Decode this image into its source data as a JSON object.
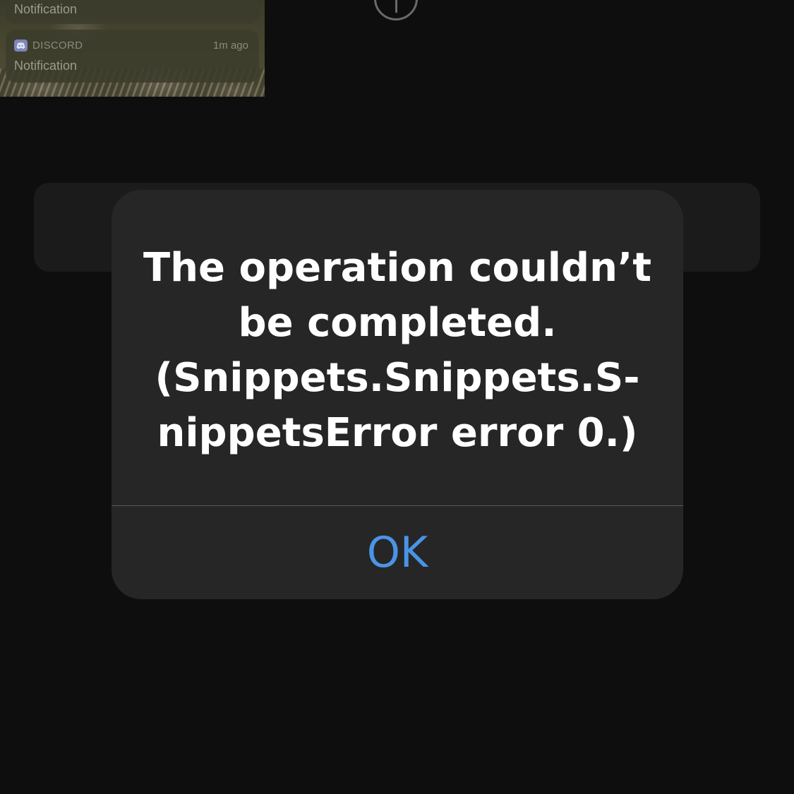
{
  "notifications": [
    {
      "body": "Notification"
    },
    {
      "app": "DISCORD",
      "time": "1m ago",
      "body": "Notification"
    }
  ],
  "add_button": {
    "icon": "plus-icon"
  },
  "alert": {
    "message": "The operation couldn’t\nbe completed.\n(Snippets.Snippets.S-\nnippetsError error 0.)",
    "ok_label": "OK"
  },
  "colors": {
    "background": "#0e0e0e",
    "alert_background": "#262626",
    "accent": "#4a94e6",
    "text": "#ffffff"
  }
}
